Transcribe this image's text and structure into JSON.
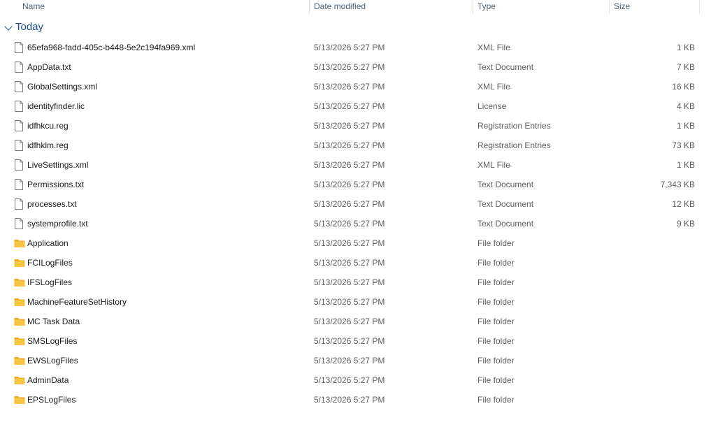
{
  "columns": {
    "name": "Name",
    "date_modified": "Date modified",
    "type": "Type",
    "size": "Size"
  },
  "group": {
    "label": "Today"
  },
  "files": [
    {
      "name": "65efa968-fadd-405c-b448-5e2c194fa969.xml",
      "date": "5/13/2026 5:27 PM",
      "type": "XML File",
      "size": "1 KB",
      "icon": "file-icon"
    },
    {
      "name": "AppData.txt",
      "date": "5/13/2026 5:27 PM",
      "type": "Text Document",
      "size": "7 KB",
      "icon": "file-icon"
    },
    {
      "name": "GlobalSettings.xml",
      "date": "5/13/2026 5:27 PM",
      "type": "XML File",
      "size": "16 KB",
      "icon": "file-icon"
    },
    {
      "name": "identityfinder.lic",
      "date": "5/13/2026 5:27 PM",
      "type": "License",
      "size": "4 KB",
      "icon": "file-icon"
    },
    {
      "name": "idfhkcu.reg",
      "date": "5/13/2026 5:27 PM",
      "type": "Registration Entries",
      "size": "1 KB",
      "icon": "file-icon"
    },
    {
      "name": "idfhklm.reg",
      "date": "5/13/2026 5:27 PM",
      "type": "Registration Entries",
      "size": "73 KB",
      "icon": "file-icon"
    },
    {
      "name": "LiveSettings.xml",
      "date": "5/13/2026 5:27 PM",
      "type": "XML File",
      "size": "1 KB",
      "icon": "file-icon"
    },
    {
      "name": "Permissions.txt",
      "date": "5/13/2026 5:27 PM",
      "type": "Text Document",
      "size": "7,343 KB",
      "icon": "file-icon"
    },
    {
      "name": "processes.txt",
      "date": "5/13/2026 5:27 PM",
      "type": "Text Document",
      "size": "12 KB",
      "icon": "file-icon"
    },
    {
      "name": "systemprofile.txt",
      "date": "5/13/2026 5:27 PM",
      "type": "Text Document",
      "size": "9 KB",
      "icon": "file-icon"
    },
    {
      "name": "Application",
      "date": "5/13/2026 5:27 PM",
      "type": "File folder",
      "size": "",
      "icon": "folder-icon"
    },
    {
      "name": "FCILogFiles",
      "date": "5/13/2026 5:27 PM",
      "type": "File folder",
      "size": "",
      "icon": "folder-icon"
    },
    {
      "name": "IFSLogFiles",
      "date": "5/13/2026 5:27 PM",
      "type": "File folder",
      "size": "",
      "icon": "folder-icon"
    },
    {
      "name": "MachineFeatureSetHistory",
      "date": "5/13/2026 5:27 PM",
      "type": "File folder",
      "size": "",
      "icon": "folder-icon"
    },
    {
      "name": "MC Task Data",
      "date": "5/13/2026 5:27 PM",
      "type": "File folder",
      "size": "",
      "icon": "folder-icon"
    },
    {
      "name": "SMSLogFiles",
      "date": "5/13/2026 5:27 PM",
      "type": "File folder",
      "size": "",
      "icon": "folder-icon"
    },
    {
      "name": "EWSLogFiles",
      "date": "5/13/2026 5:27 PM",
      "type": "File folder",
      "size": "",
      "icon": "folder-icon"
    },
    {
      "name": "AdminData",
      "date": "5/13/2026 5:27 PM",
      "type": "File folder",
      "size": "",
      "icon": "folder-icon"
    },
    {
      "name": "EPSLogFiles",
      "date": "5/13/2026 5:27 PM",
      "type": "File folder",
      "size": "",
      "icon": "folder-icon"
    }
  ],
  "colors": {
    "header_text": "#4c607a",
    "group_accent": "#1c4a8f",
    "folder_fill": "#f8c443",
    "folder_tab": "#e7a91a"
  }
}
